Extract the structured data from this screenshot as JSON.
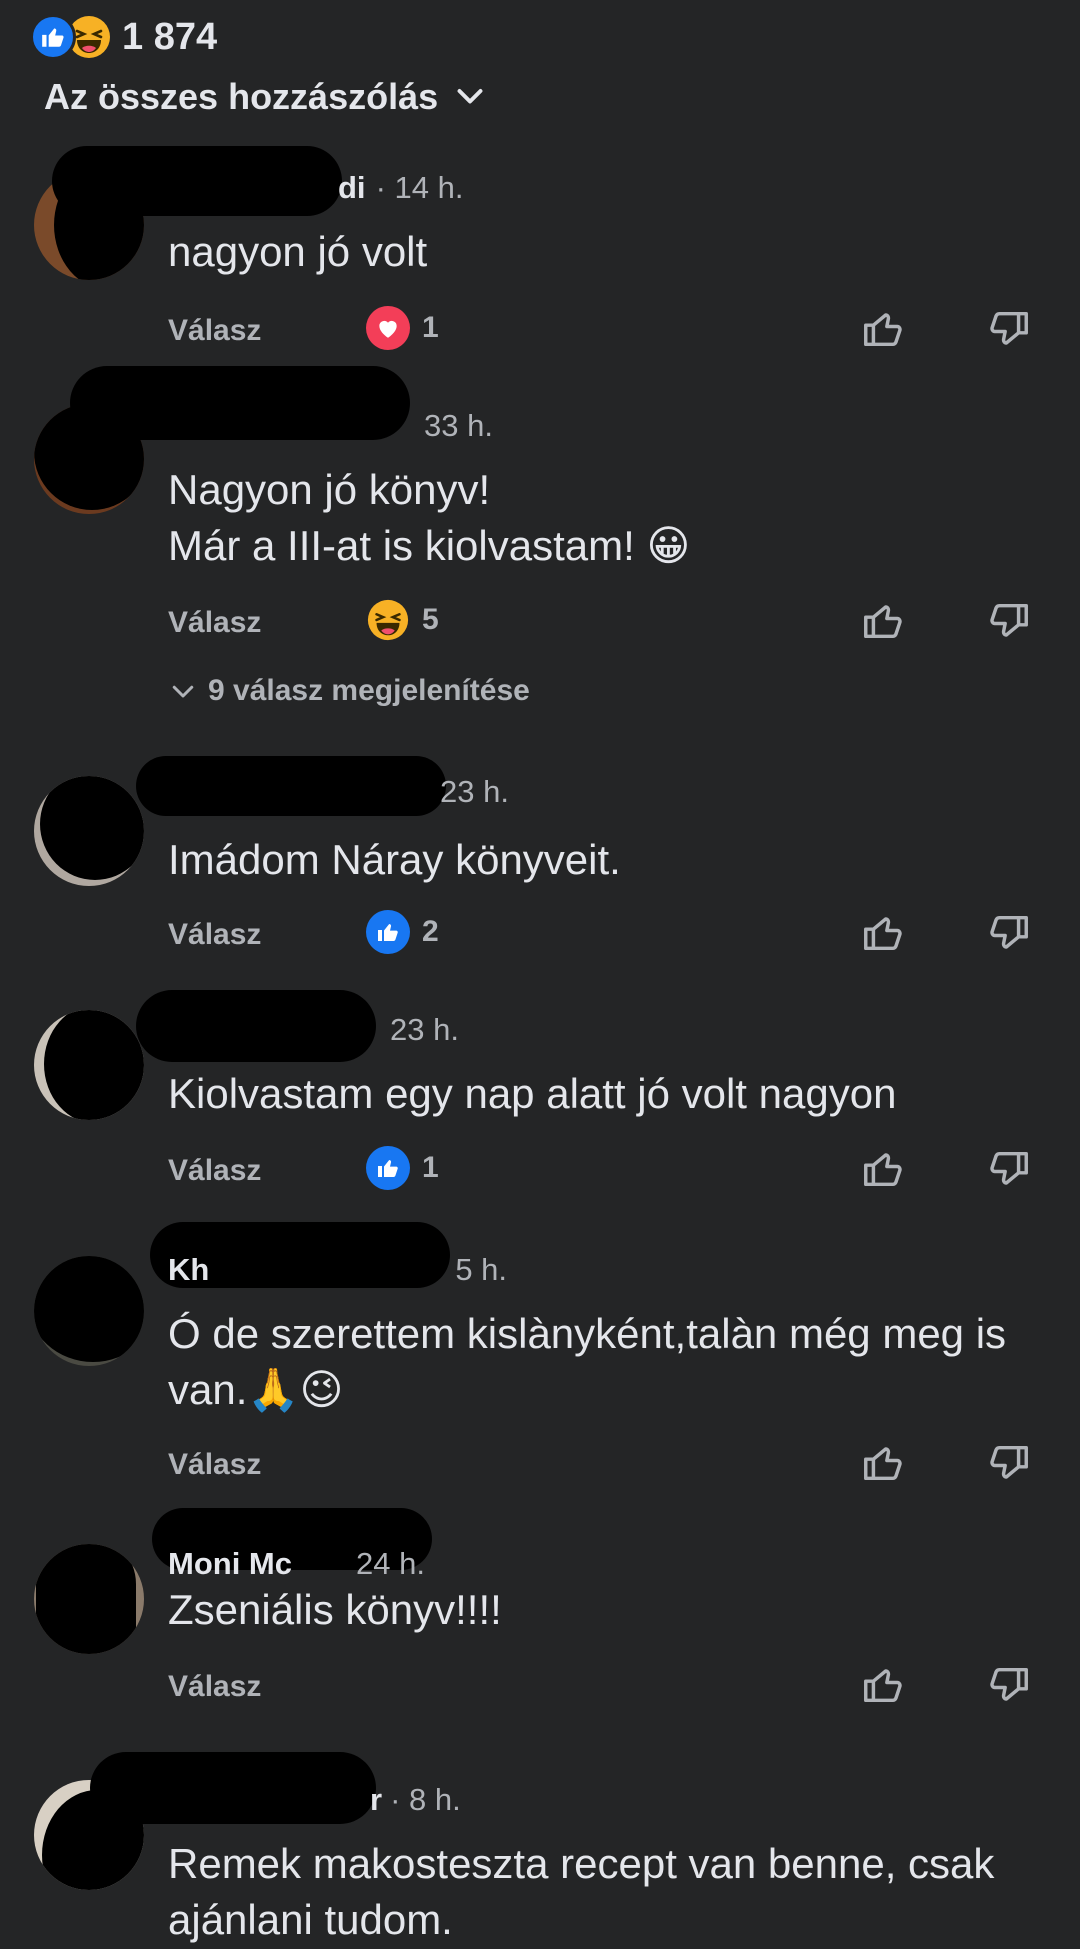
{
  "header": {
    "reaction_count": "1 874",
    "filter_label": "Az összes hozzászólás"
  },
  "comments": [
    {
      "name_visible": "di",
      "time": "· 14 h.",
      "text": "nagyon jó volt",
      "reply_label": "Válasz",
      "reaction": {
        "type": "love",
        "count": "1"
      }
    },
    {
      "name_visible": "",
      "time": "33 h.",
      "text": "Nagyon jó könyv!\nMár a III-at is kiolvastam! 😀",
      "reply_label": "Válasz",
      "reaction": {
        "type": "haha",
        "count": "5"
      },
      "view_replies": "9 válasz megjelenítése"
    },
    {
      "name_visible": "",
      "time": "23 h.",
      "text": "Imádom Náray könyveit.",
      "reply_label": "Válasz",
      "reaction": {
        "type": "like",
        "count": "2"
      }
    },
    {
      "name_visible": "",
      "time": "23 h.",
      "text": "Kiolvastam egy nap alatt jó volt nagyon",
      "reply_label": "Válasz",
      "reaction": {
        "type": "like",
        "count": "1"
      }
    },
    {
      "name_visible": "Kh",
      "time": "5 h.",
      "text": "Ó de szerettem kislànyként,talàn még meg is van.🙏😉",
      "reply_label": "Válasz"
    },
    {
      "name_visible": "Moni Mc",
      "time": "24 h.",
      "text": "Zseniális könyv!!!!",
      "reply_label": "Válasz"
    },
    {
      "name_visible": "r",
      "time": "· 8 h.",
      "text": "Remek makosteszta recept van benne, csak ajánlani tudom."
    }
  ]
}
